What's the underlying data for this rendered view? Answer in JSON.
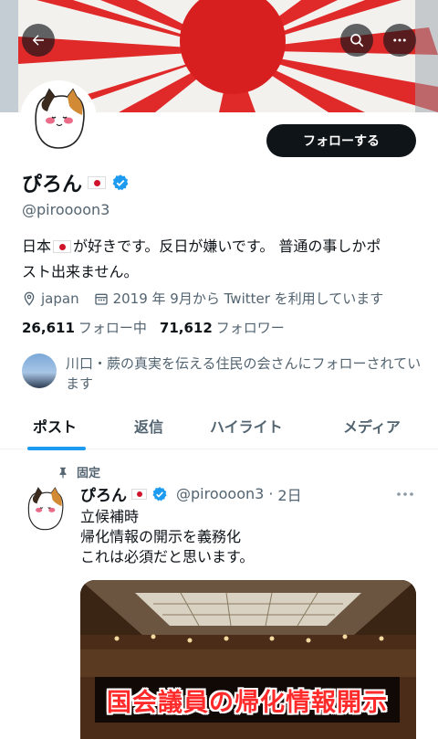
{
  "header": {
    "back_icon": "arrow-left-icon",
    "search_icon": "search-icon",
    "more_icon": "more-horizontal-icon"
  },
  "profile": {
    "name": "ぴろん",
    "handle": "@piroooon3",
    "follow_label": "フォローする",
    "bio_part1": "日本",
    "bio_part2": "が好きです。反日が嫌いです。 普通の事しかポ",
    "bio_part3": "スト出来ません。",
    "location": "japan",
    "joined": "2019 年 9月から Twitter を利用しています",
    "following_count": "26,611",
    "following_label": "フォロー中",
    "followers_count": "71,612",
    "followers_label": "フォロワー",
    "followed_by": "川口・蕨の真実を伝える住民の会さんにフォローされています",
    "colors": {
      "accent": "#1d9bf0",
      "verified": "#1d9bf0",
      "text": "#0f1419",
      "secondary": "#536471"
    }
  },
  "tabs": [
    {
      "label": "ポスト",
      "active": true
    },
    {
      "label": "返信",
      "active": false
    },
    {
      "label": "ハイライト",
      "active": false
    },
    {
      "label": "メディア",
      "active": false
    }
  ],
  "post": {
    "pinned_label": "固定",
    "name": "ぴろん",
    "handle": "@piroooon3",
    "time": "2日",
    "lines": [
      "立候補時",
      "帰化情報の開示を義務化",
      "これは必須だと思います。"
    ],
    "media_caption": "国会議員の帰化情報開示"
  }
}
